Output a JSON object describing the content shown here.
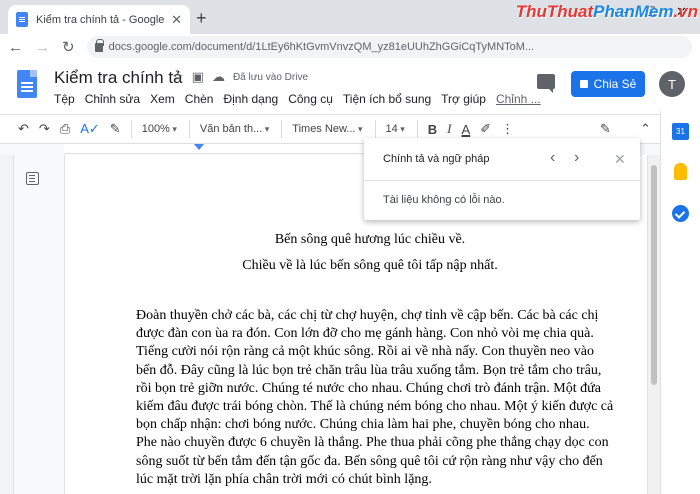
{
  "browser": {
    "tab_title": "Kiểm tra chính tả - Google Tài liệu",
    "tab_close": "✕",
    "new_tab": "+",
    "win_min": "—",
    "win_max": "☐",
    "win_close": "✕",
    "back": "←",
    "forward": "→",
    "reload": "↻",
    "url": "docs.google.com/document/d/1LtEy6hKtGvmVnvzQM_yz81eUUhZhGGiCqTyMNToM...",
    "watermark_part1": "ThuThuat",
    "watermark_part2": "PhanMem",
    "watermark_part3": ".vn"
  },
  "docs": {
    "title": "Kiểm tra chính tả",
    "star": "☆",
    "move": "▣",
    "saved_status": "Đã lưu vào Drive",
    "menu": [
      "Tệp",
      "Chỉnh sửa",
      "Xem",
      "Chèn",
      "Định dạng",
      "Công cụ",
      "Tiện ích bổ sung",
      "Trợ giúp",
      "Chỉnh ..."
    ],
    "share_label": "Chia Sẻ",
    "avatar_initial": "T"
  },
  "toolbar": {
    "undo": "↶",
    "redo": "↷",
    "print": "⎙",
    "spellcheck": "A✓",
    "paint_format": "✎",
    "zoom": "100%",
    "style": "Văn bản th...",
    "font": "Times New...",
    "size": "14",
    "bold": "B",
    "italic": "I",
    "text_color": "A",
    "highlight": "✐",
    "more": "⋮",
    "edit_mode": "✎",
    "collapse": "⌃"
  },
  "grammar_panel": {
    "title": "Chính tả và ngữ pháp",
    "prev": "‹",
    "next": "›",
    "close": "✕",
    "message": "Tài liệu không có lỗi nào."
  },
  "document": {
    "heading1": "Bến sông quê hương lúc chiều về.",
    "heading2": "Chiều về là lúc bến sông quê tôi tấp nập nhất.",
    "paragraph": "Đoàn thuyền chở các bà, các chị từ chợ huyện, chợ tỉnh về cập bến. Các bà các chị được đàn con ùa ra đón. Con lớn đỡ cho mẹ gánh hàng. Con nhỏ vòi mẹ chia quà. Tiếng cười nói rộn ràng cả một khúc sông. Rồi ai về nhà nấy. Con thuyền neo vào bến đỗ. Đây cũng là lúc bọn trẻ chăn trâu lùa trâu xuống tắm. Bọn trẻ tắm cho trâu, rồi bọn trẻ giỡn nước. Chúng té nước cho nhau. Chúng chơi trò đánh trận. Một đứa kiếm đâu được trái bóng chòn. Thế là chúng ném bóng cho nhau. Một ý kiến được cả bọn chấp nhận: chơi bóng nước. Chúng chia làm hai phe, chuyền bóng cho nhau. Phe nào chuyền được 6 chuyền là thắng. Phe thua phải cõng phe thắng chạy dọc con sông suốt từ bến tắm đến tận gốc đa. Bến sông quê tôi cứ rộn ràng như vậy cho đến lúc mặt trời lặn phía chân trời mới có chút bình lặng."
  },
  "side_panel": {
    "calendar_day": "31"
  }
}
